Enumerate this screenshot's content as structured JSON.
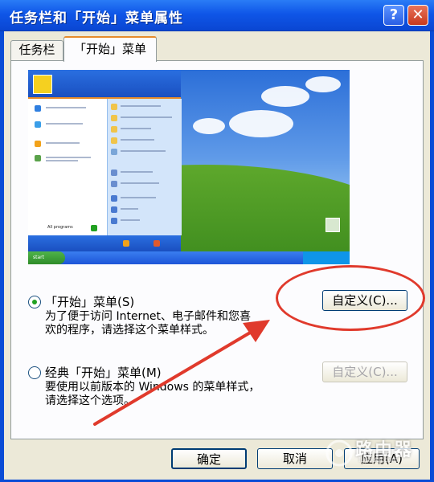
{
  "window": {
    "title": "任务栏和「开始」菜单属性",
    "help": "?",
    "close": "✕"
  },
  "tabs": [
    {
      "label": "任务栏"
    },
    {
      "label": "「开始」菜单",
      "active": true
    }
  ],
  "preview": {
    "all_programs": "All programs",
    "start_label": "start"
  },
  "options": [
    {
      "label": "「开始」菜单(S)",
      "selected": true,
      "desc_line1": "为了便于访问 Internet、电子邮件和您喜",
      "desc_line2": "欢的程序，请选择这个菜单样式。",
      "button": "自定义(C)..."
    },
    {
      "label": "经典「开始」菜单(M)",
      "selected": false,
      "desc_line1": "要使用以前版本的 Windows 的菜单样式，",
      "desc_line2": "请选择这个选项。",
      "button": "自定义(C)..."
    }
  ],
  "footer": {
    "ok": "确定",
    "cancel": "取消",
    "apply": "应用(A)"
  },
  "watermark": {
    "text": "路由器",
    "sub": "luyouqi.com"
  },
  "colors": {
    "titlebar": "#0f56e8",
    "annotation": "#e03a2c",
    "radio_selected": "#21a121"
  }
}
